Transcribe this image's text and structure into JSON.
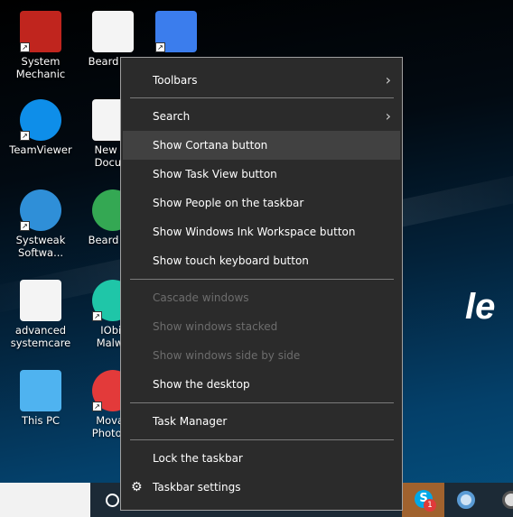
{
  "desktop": {
    "icons": [
      {
        "label": "System\nMechanic",
        "icon": "system-mechanic-icon",
        "color": "#c0251e",
        "shortcut": true
      },
      {
        "label": "Beard sty",
        "icon": "image-file-icon",
        "color": "#f4f4f4",
        "shortcut": false
      },
      {
        "label": "",
        "icon": "google-docs-icon",
        "color": "#3b7ded",
        "shortcut": true
      },
      {
        "label": "TeamViewer",
        "icon": "teamviewer-icon",
        "color": "#0e8ee9",
        "shortcut": true
      },
      {
        "label": "New Te\nDocum",
        "icon": "text-file-icon",
        "color": "#f4f4f4",
        "shortcut": false
      },
      {
        "label": "Systweak\nSoftwa...",
        "icon": "systweak-icon",
        "color": "#2f8fd8",
        "shortcut": true
      },
      {
        "label": "Beard sty",
        "icon": "chrome-icon",
        "color": "#34a853",
        "shortcut": false
      },
      {
        "label": "advanced\nsystemcare",
        "icon": "image-file-icon",
        "color": "#f4f4f4",
        "shortcut": false
      },
      {
        "label": "IObit\nMalwa",
        "icon": "iobit-malware-icon",
        "color": "#1fc6a8",
        "shortcut": true
      },
      {
        "label": "This PC",
        "icon": "this-pc-icon",
        "color": "#4fb3f0",
        "shortcut": false
      },
      {
        "label": "Movav\nPhoto M",
        "icon": "movavi-icon",
        "color": "#e33a3a",
        "shortcut": true
      }
    ],
    "wallpaper_logo": "le"
  },
  "menu": {
    "items": [
      {
        "label": "Toolbars",
        "submenu": true
      },
      {
        "label": "Search",
        "submenu": true
      },
      {
        "label": "Show Cortana button",
        "highlighted": true
      },
      {
        "label": "Show Task View button"
      },
      {
        "label": "Show People on the taskbar"
      },
      {
        "label": "Show Windows Ink Workspace button"
      },
      {
        "label": "Show touch keyboard button"
      },
      {
        "label": "Cascade windows",
        "disabled": true
      },
      {
        "label": "Show windows stacked",
        "disabled": true
      },
      {
        "label": "Show windows side by side",
        "disabled": true
      },
      {
        "label": "Show the desktop"
      },
      {
        "label": "Task Manager"
      },
      {
        "label": "Lock the taskbar"
      },
      {
        "label": "Taskbar settings",
        "icon": "gear-icon"
      }
    ]
  },
  "taskbar": {
    "skype_badge": "1",
    "skype_letter": "S"
  }
}
